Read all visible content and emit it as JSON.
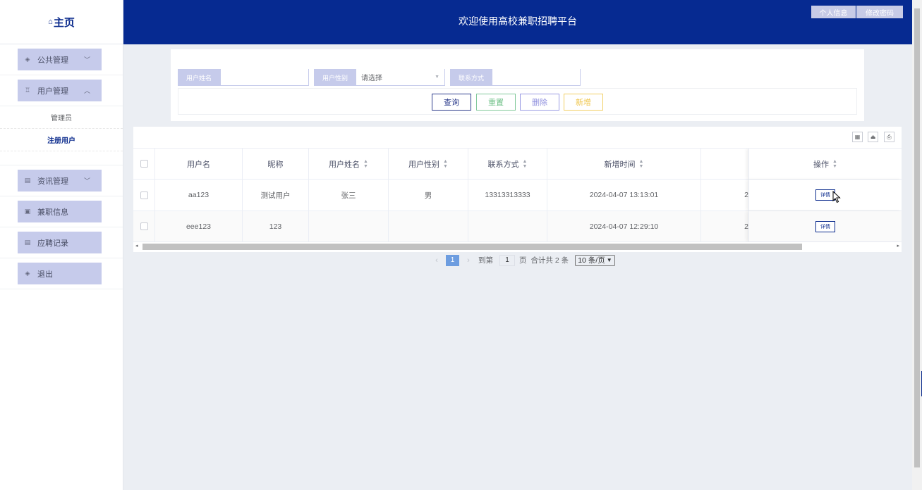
{
  "sidebar": {
    "logo_icon": "home-icon",
    "logo_text": "主页",
    "menus": [
      {
        "label": "公共管理",
        "icon": "layers-icon"
      },
      {
        "label": "用户管理",
        "icon": "user-icon"
      },
      {
        "label": "资讯管理",
        "icon": "list-icon"
      },
      {
        "label": "兼职信息",
        "icon": "doc-icon"
      },
      {
        "label": "应聘记录",
        "icon": "list-icon"
      },
      {
        "label": "退出",
        "icon": "layers-icon"
      }
    ],
    "submenu": [
      "管理员",
      "注册用户"
    ],
    "active_submenu": "注册用户"
  },
  "header": {
    "title": "欢迎使用高校兼职招聘平台",
    "profile_label": "个人信息",
    "password_label": "修改密码",
    "bg_color": "#062a91"
  },
  "search": {
    "name_label": "用户姓名",
    "name_value": "",
    "gender_label": "用户性别",
    "gender_placeholder": "请选择",
    "contact_label": "联系方式",
    "contact_value": "",
    "query_label": "查询",
    "reset_label": "重置",
    "delete_label": "删除",
    "add_label": "新增"
  },
  "table": {
    "columns": [
      "用户名",
      "昵称",
      "用户姓名",
      "用户性别",
      "联系方式",
      "新增时间",
      "",
      "操作"
    ],
    "rows": [
      {
        "username": "aa123",
        "nickname": "测试用户",
        "realname": "张三",
        "gender": "男",
        "phone": "13313313333",
        "created": "2024-04-07 13:13:01",
        "extra": "2",
        "action": "详情"
      },
      {
        "username": "eee123",
        "nickname": "123",
        "realname": "",
        "gender": "",
        "phone": "",
        "created": "2024-04-07 12:29:10",
        "extra": "2",
        "action": "详情"
      }
    ]
  },
  "pager": {
    "prev": "‹",
    "current": "1",
    "next": "›",
    "goto_label": "到第",
    "goto_value": "1",
    "page_unit": "页",
    "total_text": "合计共 2 条",
    "page_size": "10 条/页"
  },
  "colors": {
    "primary": "#0a2a8c",
    "menu_bg": "#c6cbeb",
    "reset": "#6cbf85",
    "delete": "#8c8ddd",
    "add": "#efc54a",
    "page_active": "#6d9de0"
  }
}
